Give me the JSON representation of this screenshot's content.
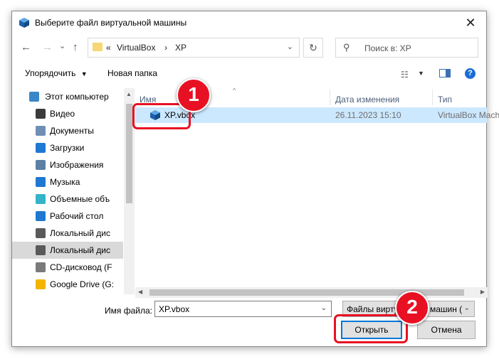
{
  "dialog": {
    "title": "Выберите файл виртуальной машины",
    "close_glyph": "✕"
  },
  "navigation": {
    "back_glyph": "←",
    "forward_glyph": "→",
    "recent_glyph": "⌄",
    "up_glyph": "↑",
    "refresh_glyph": "↻",
    "address": {
      "overflow": "«",
      "crumbs": [
        "VirtualBox",
        "XP"
      ],
      "separator": "›",
      "dropdown_glyph": "⌄"
    },
    "search": {
      "icon_glyph": "⚲",
      "placeholder": "Поиск в: XP"
    }
  },
  "toolbar": {
    "organize_label": "Упорядочить",
    "new_folder_label": "Новая папка",
    "help_glyph": "?"
  },
  "sidebar": {
    "items": [
      {
        "label": "Этот компьютер",
        "icon": "this-pc-icon",
        "color": "#3a86c8"
      },
      {
        "label": "Видео",
        "icon": "video-icon",
        "color": "#3b3b3b"
      },
      {
        "label": "Документы",
        "icon": "documents-icon",
        "color": "#6f8fb5"
      },
      {
        "label": "Загрузки",
        "icon": "downloads-icon",
        "color": "#1f78d1"
      },
      {
        "label": "Изображения",
        "icon": "pictures-icon",
        "color": "#5c7fa3"
      },
      {
        "label": "Музыка",
        "icon": "music-icon",
        "color": "#1f78d1"
      },
      {
        "label": "Объемные объ",
        "icon": "3d-objects-icon",
        "color": "#34b3c9"
      },
      {
        "label": "Рабочий стол",
        "icon": "desktop-icon",
        "color": "#1f78d1"
      },
      {
        "label": "Локальный дис",
        "icon": "local-disk-icon",
        "color": "#5a5a5a"
      },
      {
        "label": "Локальный дис",
        "icon": "local-disk-icon",
        "color": "#5a5a5a",
        "selected": true
      },
      {
        "label": "CD-дисковод (F",
        "icon": "cd-drive-icon",
        "color": "#7a7a7a"
      },
      {
        "label": "Google Drive (G:",
        "icon": "google-drive-icon",
        "color": "#f4b400"
      }
    ]
  },
  "file_list": {
    "columns": [
      "Имя",
      "Дата изменения",
      "Тип"
    ],
    "rows": [
      {
        "name": "XP.vbox",
        "date": "26.11.2023 15:10",
        "type": "VirtualBox Machi"
      }
    ]
  },
  "footer": {
    "filename_label": "Имя файла:",
    "filename_value": "XP.vbox",
    "filetype_value": "Файлы виртуальных машин (",
    "open_label": "Открыть",
    "cancel_label": "Отмена"
  },
  "annotations": {
    "badge1": "1",
    "badge2": "2",
    "color": "#e81123"
  }
}
